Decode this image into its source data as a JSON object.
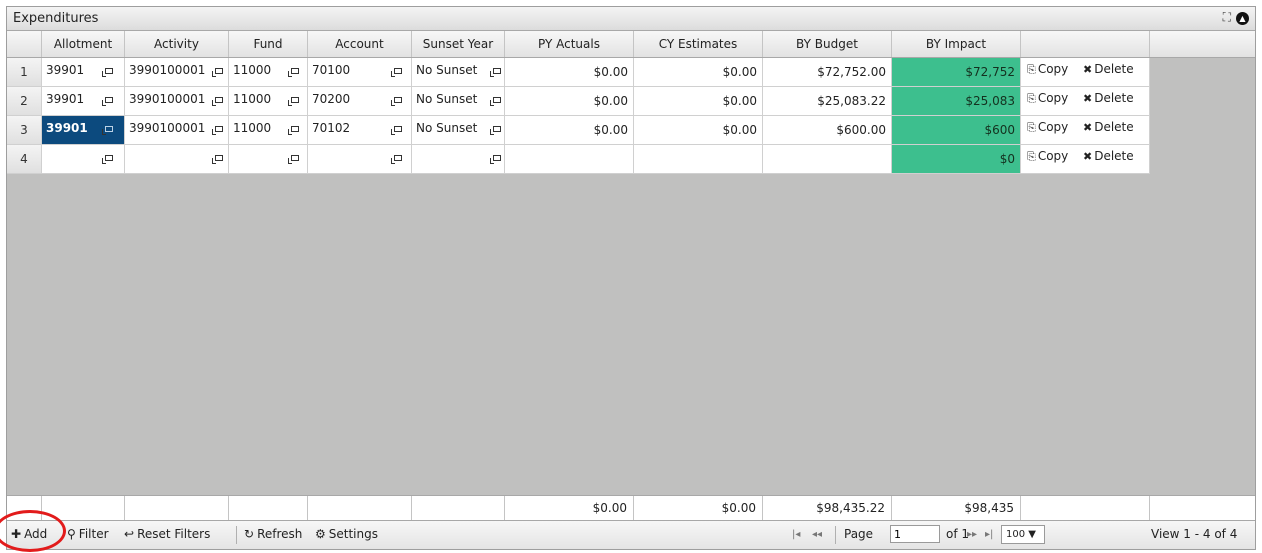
{
  "panel": {
    "title": "Expenditures",
    "expand_icon": "expand-icon",
    "collapse_icon": "collapse-circle-icon"
  },
  "columns": [
    "Allotment",
    "Activity",
    "Fund",
    "Account",
    "Sunset Year",
    "PY Actuals",
    "CY Estimates",
    "BY Budget",
    "BY Impact"
  ],
  "rows": [
    {
      "num": "1",
      "allotment": "39901",
      "activity": "3990100001",
      "fund": "11000",
      "account": "70100",
      "sunset": "No Sunset",
      "py": "$0.00",
      "cy": "$0.00",
      "by_budget": "$72,752.00",
      "by_impact": "$72,752",
      "copy": "Copy",
      "delete": "Delete"
    },
    {
      "num": "2",
      "allotment": "39901",
      "activity": "3990100001",
      "fund": "11000",
      "account": "70200",
      "sunset": "No Sunset",
      "py": "$0.00",
      "cy": "$0.00",
      "by_budget": "$25,083.22",
      "by_impact": "$25,083",
      "copy": "Copy",
      "delete": "Delete"
    },
    {
      "num": "3",
      "allotment": "39901",
      "activity": "3990100001",
      "fund": "11000",
      "account": "70102",
      "sunset": "No Sunset",
      "py": "$0.00",
      "cy": "$0.00",
      "by_budget": "$600.00",
      "by_impact": "$600",
      "copy": "Copy",
      "delete": "Delete"
    },
    {
      "num": "4",
      "allotment": "",
      "activity": "",
      "fund": "",
      "account": "",
      "sunset": "",
      "py": "",
      "cy": "",
      "by_budget": "",
      "by_impact": "$0",
      "copy": "Copy",
      "delete": "Delete"
    }
  ],
  "totals": {
    "py": "$0.00",
    "cy": "$0.00",
    "by_budget": "$98,435.22",
    "by_impact": "$98,435"
  },
  "toolbar": {
    "add": "Add",
    "filter": "Filter",
    "reset": "Reset Filters",
    "refresh": "Refresh",
    "settings": "Settings"
  },
  "pager": {
    "page_label": "Page",
    "page_value": "1",
    "of_label": "of 1",
    "rows_per_page": "100 ▼",
    "view": "View 1 - 4 of 4"
  },
  "colors": {
    "impact_green": "#3dbf8e",
    "selected_blue": "#0c4a7e",
    "annotation_red": "#e21b1b"
  }
}
